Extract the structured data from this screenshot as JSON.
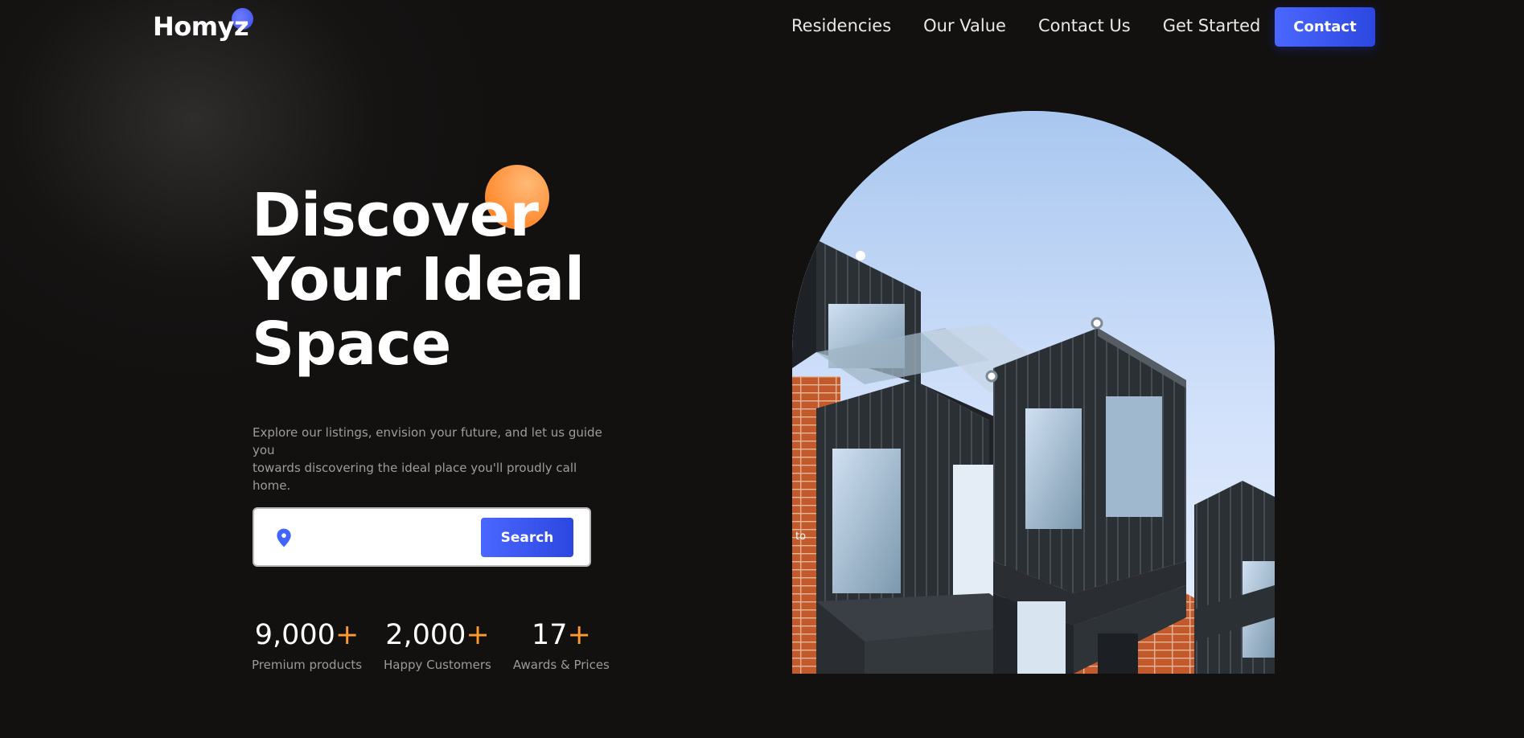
{
  "brand": {
    "name": "Homyz"
  },
  "nav": {
    "items": [
      "Residencies",
      "Our Value",
      "Contact Us",
      "Get Started"
    ],
    "contact_label": "Contact"
  },
  "hero": {
    "title_lines": [
      "Discover",
      "Your Ideal",
      "Space"
    ],
    "subtitle_line1": "Explore our listings, envision your future, and let us guide you",
    "subtitle_line2": "towards discovering the ideal place you'll proudly call home.",
    "search": {
      "value": "",
      "placeholder": "",
      "button_label": "Search",
      "icon": "location-pin-icon"
    },
    "stats": [
      {
        "number": "9,000",
        "suffix": "+",
        "label": "Premium products"
      },
      {
        "number": "2,000",
        "suffix": "+",
        "label": "Happy Customers"
      },
      {
        "number": "17",
        "suffix": "+",
        "label": "Awards & Prices"
      }
    ],
    "image_caption": "to"
  },
  "colors": {
    "background": "#131110",
    "accent_blue": "#4066ff",
    "accent_orange": "#ffa041",
    "text_primary": "#ffffff",
    "text_secondary": "#9c9c9c"
  }
}
